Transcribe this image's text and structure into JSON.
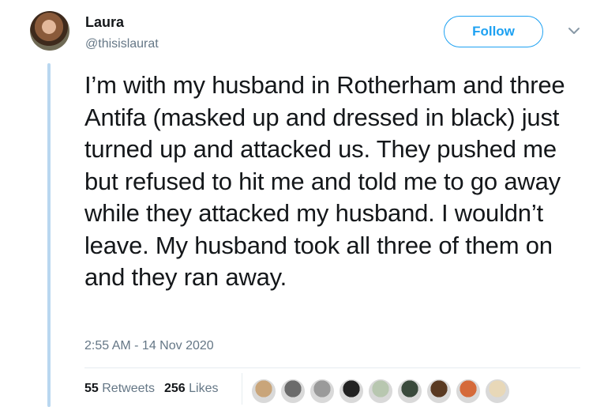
{
  "author": {
    "name": "Laura",
    "handle": "@thisislaurat"
  },
  "follow_button": {
    "label": "Follow"
  },
  "tweet": {
    "text": "I’m with my husband in Rotherham and three Antifa (masked up and dressed in black) just turned up and attacked us. They pushed me but refused to hit me and told me to go away while they attacked my husband. I wouldn’t leave. My husband took all three of them on and they ran away.",
    "timestamp": "2:55 AM - 14 Nov 2020"
  },
  "stats": {
    "retweets_count": "55",
    "retweets_label": "Retweets",
    "likes_count": "256",
    "likes_label": "Likes"
  },
  "likers": [
    {
      "color": "#c9a57a"
    },
    {
      "color": "#6b6b6b"
    },
    {
      "color": "#9a9a9a"
    },
    {
      "color": "#222222"
    },
    {
      "color": "#b8c7b0"
    },
    {
      "color": "#3a4a3c"
    },
    {
      "color": "#5a3a22"
    },
    {
      "color": "#d56a3a"
    },
    {
      "color": "#e8d8b8"
    }
  ],
  "colors": {
    "accent": "#1da1f2",
    "secondary_text": "#657786",
    "thread_line": "#b9d7f0"
  }
}
